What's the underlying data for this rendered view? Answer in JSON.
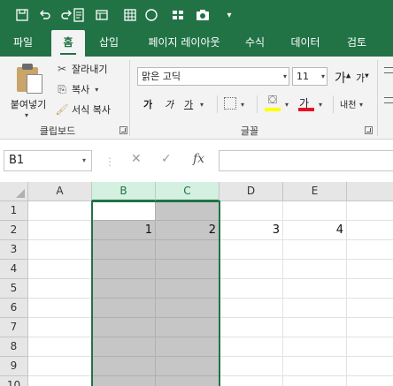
{
  "quick_access": [
    "autosave-icon",
    "undo-icon",
    "redo-icon",
    "sheet-icon",
    "print-preview-icon",
    "circle-icon",
    "grid-icon",
    "camera-icon",
    "customize-caret-icon"
  ],
  "tabs": [
    {
      "label": "파일",
      "active": false
    },
    {
      "label": "홈",
      "active": true
    },
    {
      "label": "삽입",
      "active": false
    },
    {
      "label": "페이지 레이아웃",
      "active": false
    },
    {
      "label": "수식",
      "active": false
    },
    {
      "label": "데이터",
      "active": false
    },
    {
      "label": "검토",
      "active": false
    }
  ],
  "clipboard": {
    "paste_label": "붙여넣기",
    "cut_label": "잘라내기",
    "copy_label": "복사",
    "format_painter_label": "서식 복사",
    "group_label": "클립보드"
  },
  "font": {
    "font_name": "맑은 고딕",
    "font_size": "11",
    "grow_label": "가",
    "shrink_label": "가",
    "bold_label": "가",
    "italic_label": "가",
    "underline_label": "가",
    "font_color_label": "가",
    "phonetic_label": "내천",
    "group_label": "글꼴",
    "fill_color": "#ffff00",
    "font_color": "#e81123"
  },
  "formula_bar": {
    "name_box": "B1",
    "cancel_icon": "close-icon",
    "enter_icon": "check-icon",
    "function_label": "fx",
    "formula": ""
  },
  "sheet": {
    "columns": [
      "A",
      "B",
      "C",
      "D",
      "E"
    ],
    "selected_columns": [
      "B",
      "C"
    ],
    "rows": [
      "1",
      "2",
      "3",
      "4",
      "5",
      "6",
      "7",
      "8",
      "9",
      "10"
    ],
    "row2": {
      "A": "",
      "B": "1",
      "C": "2",
      "D": "3",
      "E": "4"
    },
    "active_cell": "B1",
    "accent_color": "#217346"
  }
}
